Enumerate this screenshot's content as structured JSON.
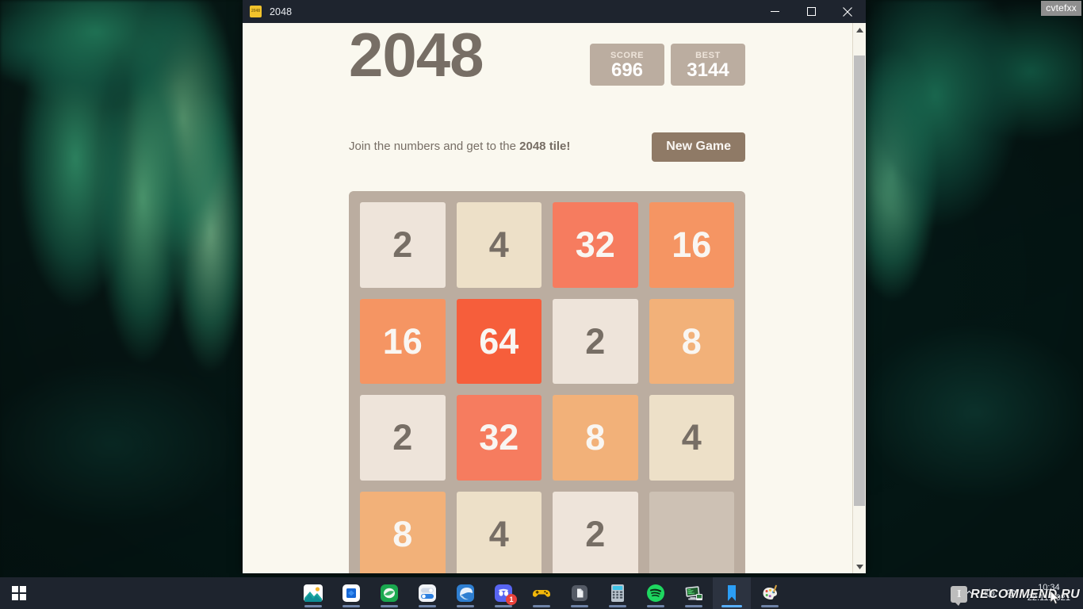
{
  "desktop": {
    "corner_tag": "cvtefxx",
    "wallpaper_description": "blurred green leaves on dark teal"
  },
  "window": {
    "title": "2048",
    "icon": "app-2048-icon",
    "controls": {
      "minimize": "minimize-icon",
      "maximize": "maximize-icon",
      "close": "close-icon"
    }
  },
  "game": {
    "title": "2048",
    "tagline_prefix": "Join the numbers and get to the ",
    "tagline_strong": "2048 tile!",
    "new_game_label": "New Game",
    "score": {
      "label": "SCORE",
      "value": "696"
    },
    "best": {
      "label": "BEST",
      "value": "3144"
    },
    "grid": {
      "rows": 4,
      "cols": 4,
      "cells": [
        [
          "2",
          "4",
          "32",
          "16"
        ],
        [
          "16",
          "64",
          "2",
          "8"
        ],
        [
          "2",
          "32",
          "8",
          "4"
        ],
        [
          "8",
          "4",
          "2",
          ""
        ]
      ]
    },
    "colors": {
      "background": "#faf8ef",
      "text": "#776e65",
      "grid_background": "#bbada0",
      "empty_cell": "#cdc1b4",
      "button": "#8f7a66",
      "tile_2": "#eee4da",
      "tile_4": "#ede0c8",
      "tile_8": "#f2b179",
      "tile_16": "#f59563",
      "tile_32": "#f67c5f",
      "tile_64": "#f65e3b"
    }
  },
  "scrollbar": {
    "up_arrow": "scroll-up-icon",
    "down_arrow": "scroll-down-icon"
  },
  "taskbar": {
    "start": "windows-start-icon",
    "items": [
      {
        "name": "photos",
        "icon": "photos-icon",
        "badge": "",
        "active": false
      },
      {
        "name": "store",
        "icon": "store-icon",
        "badge": "",
        "active": false
      },
      {
        "name": "green-app",
        "icon": "green-circle-app-icon",
        "badge": "",
        "active": false
      },
      {
        "name": "settings",
        "icon": "settings-toggle-icon",
        "badge": "",
        "active": false
      },
      {
        "name": "browser",
        "icon": "edge-browser-icon",
        "badge": "",
        "active": false
      },
      {
        "name": "discord",
        "icon": "discord-icon",
        "badge": "1",
        "active": false
      },
      {
        "name": "game-controller",
        "icon": "gamepad-icon",
        "badge": "",
        "active": false
      },
      {
        "name": "document",
        "icon": "document-icon",
        "badge": "",
        "active": false
      },
      {
        "name": "calculator",
        "icon": "calculator-icon",
        "badge": "",
        "active": false
      },
      {
        "name": "spotify",
        "icon": "spotify-icon",
        "badge": "",
        "active": false
      },
      {
        "name": "remote-desktop",
        "icon": "remote-desktop-icon",
        "badge": "",
        "active": false
      },
      {
        "name": "bookmark",
        "icon": "bookmark-icon",
        "badge": "",
        "active": true
      },
      {
        "name": "paint",
        "icon": "paint-palette-icon",
        "badge": "",
        "active": false
      }
    ],
    "tray": {
      "chevron": "chevron-up-icon",
      "volume": "speaker-icon",
      "network": "wifi-icon"
    },
    "clock": {
      "time": "10:34",
      "date": "22.11.2021"
    },
    "watermark": {
      "badge": "I",
      "text": "RECOMMEND.RU"
    }
  }
}
